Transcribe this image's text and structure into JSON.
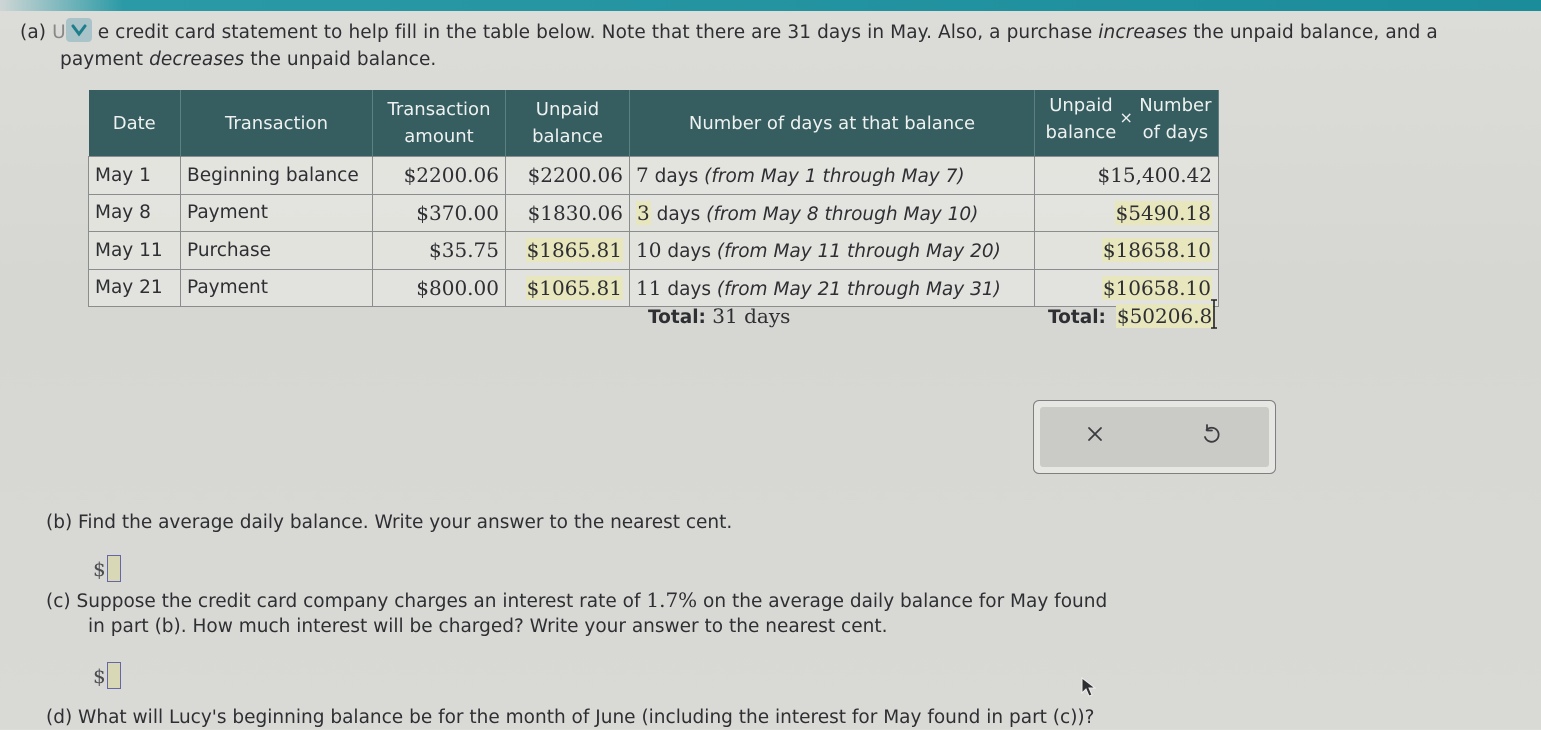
{
  "part_a": {
    "prefix": "(a)",
    "dropdown_partial": "U",
    "text_after_dropdown": "e credit card statement to help fill in the table below. Note that there are 31 days in May. Also, a purchase ",
    "emph1": "increases",
    "text_mid": " the unpaid balance, and a",
    "line2_emph_prefix": "payment ",
    "emph2": "decreases",
    "line2_rest": " the unpaid balance."
  },
  "table": {
    "headers": {
      "date": "Date",
      "transaction": "Transaction",
      "amount_l1": "Transaction",
      "amount_l2": "amount",
      "balance_l1": "Unpaid",
      "balance_l2": "balance",
      "days": "Number of days at that balance",
      "product_a_l1": "Unpaid",
      "product_a_l2": "balance",
      "product_times": "×",
      "product_b_l1": "Number",
      "product_b_l2": "of days"
    },
    "rows": [
      {
        "date": "May 1",
        "transaction": "Beginning balance",
        "amount": "$2200.06",
        "balance": "$2200.06",
        "days_count": "7",
        "days_word": " days ",
        "days_range": "(from May 1 through May 7)",
        "product": "$15,400.42"
      },
      {
        "date": "May 8",
        "transaction": "Payment",
        "amount": "$370.00",
        "balance": "$1830.06",
        "days_count": "3",
        "days_word": " days ",
        "days_range": "(from May 8 through May 10)",
        "product": "$5490.18"
      },
      {
        "date": "May 11",
        "transaction": "Purchase",
        "amount": "$35.75",
        "balance": "$1865.81",
        "days_count": "10",
        "days_word": " days ",
        "days_range": "(from May 11 through May 20)",
        "product": "$18658.10"
      },
      {
        "date": "May 21",
        "transaction": "Payment",
        "amount": "$800.00",
        "balance": "$1065.81",
        "days_count": "11",
        "days_word": " days ",
        "days_range": "(from May 21 through May 31)",
        "product": "$10658.10"
      }
    ],
    "total_days_label": "Total:",
    "total_days_value": " 31 days",
    "total_product_label": "Total:",
    "total_product_value": "$50206.8"
  },
  "actions": {
    "clear_icon": "x-icon",
    "undo_icon": "undo-icon"
  },
  "part_b": {
    "text": "(b) Find the average daily balance. Write your answer to the nearest cent.",
    "currency": "$",
    "value": ""
  },
  "part_c": {
    "line1_pre": "(c) Suppose the credit card company charges an interest rate of ",
    "rate": "1.7%",
    "line1_post": " on the average daily balance for May found",
    "line2": "in part (b). How much interest will be charged? Write your answer to the nearest cent.",
    "currency": "$",
    "value": ""
  },
  "part_d": {
    "text": "(d) What will Lucy's beginning balance be for the month of June (including the interest for May found in part (c))?"
  }
}
